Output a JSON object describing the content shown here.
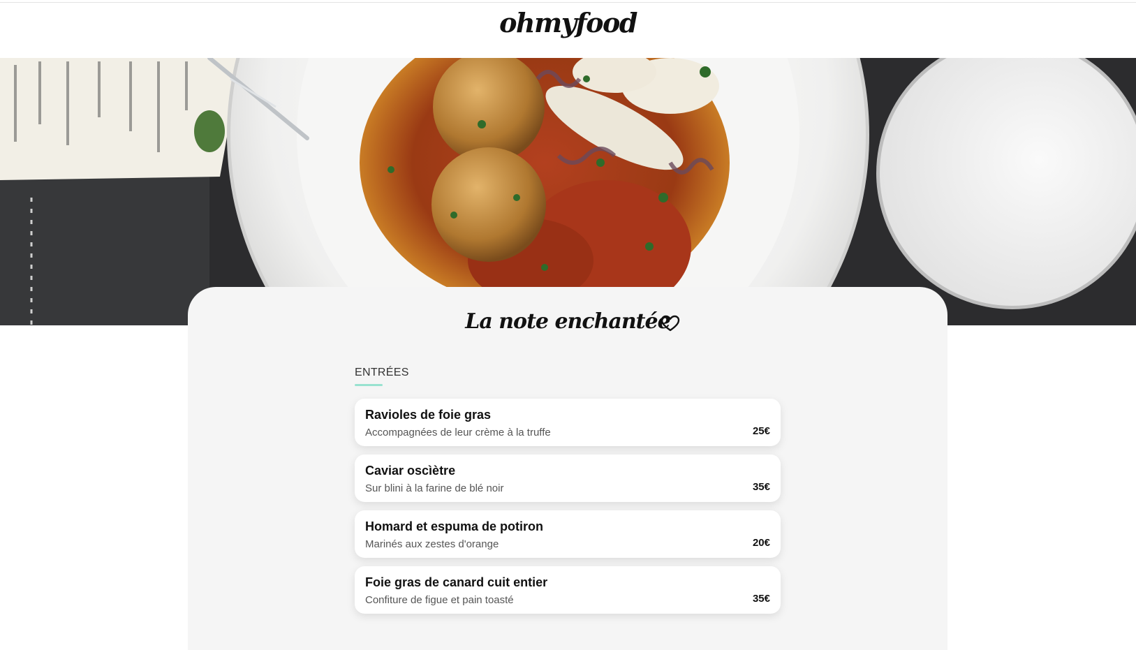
{
  "header": {
    "logo": "ohmyfood"
  },
  "hero": {
    "image": "plate of arancini balls, grilled squid and tomato sauce"
  },
  "restaurant": {
    "name": "La note enchantée",
    "favorite_icon": "heart-icon"
  },
  "menu": {
    "section_title": "ENTRÉES",
    "items": [
      {
        "name": "Ravioles de foie gras",
        "description": "Accompagnées de leur crème à la truffe",
        "price": "25€"
      },
      {
        "name": "Caviar oscìètre",
        "description": "Sur blini à la farine de blé noir",
        "price": "35€"
      },
      {
        "name": "Homard et espuma de potiron",
        "description": "Marinés aux zestes d'orange",
        "price": "20€"
      },
      {
        "name": "Foie gras de canard cuit entier",
        "description": "Confiture de figue et pain toasté",
        "price": "35€"
      }
    ]
  },
  "colors": {
    "accent": "#99e2d0",
    "panel_background": "#f5f5f5",
    "text": "#111111"
  }
}
